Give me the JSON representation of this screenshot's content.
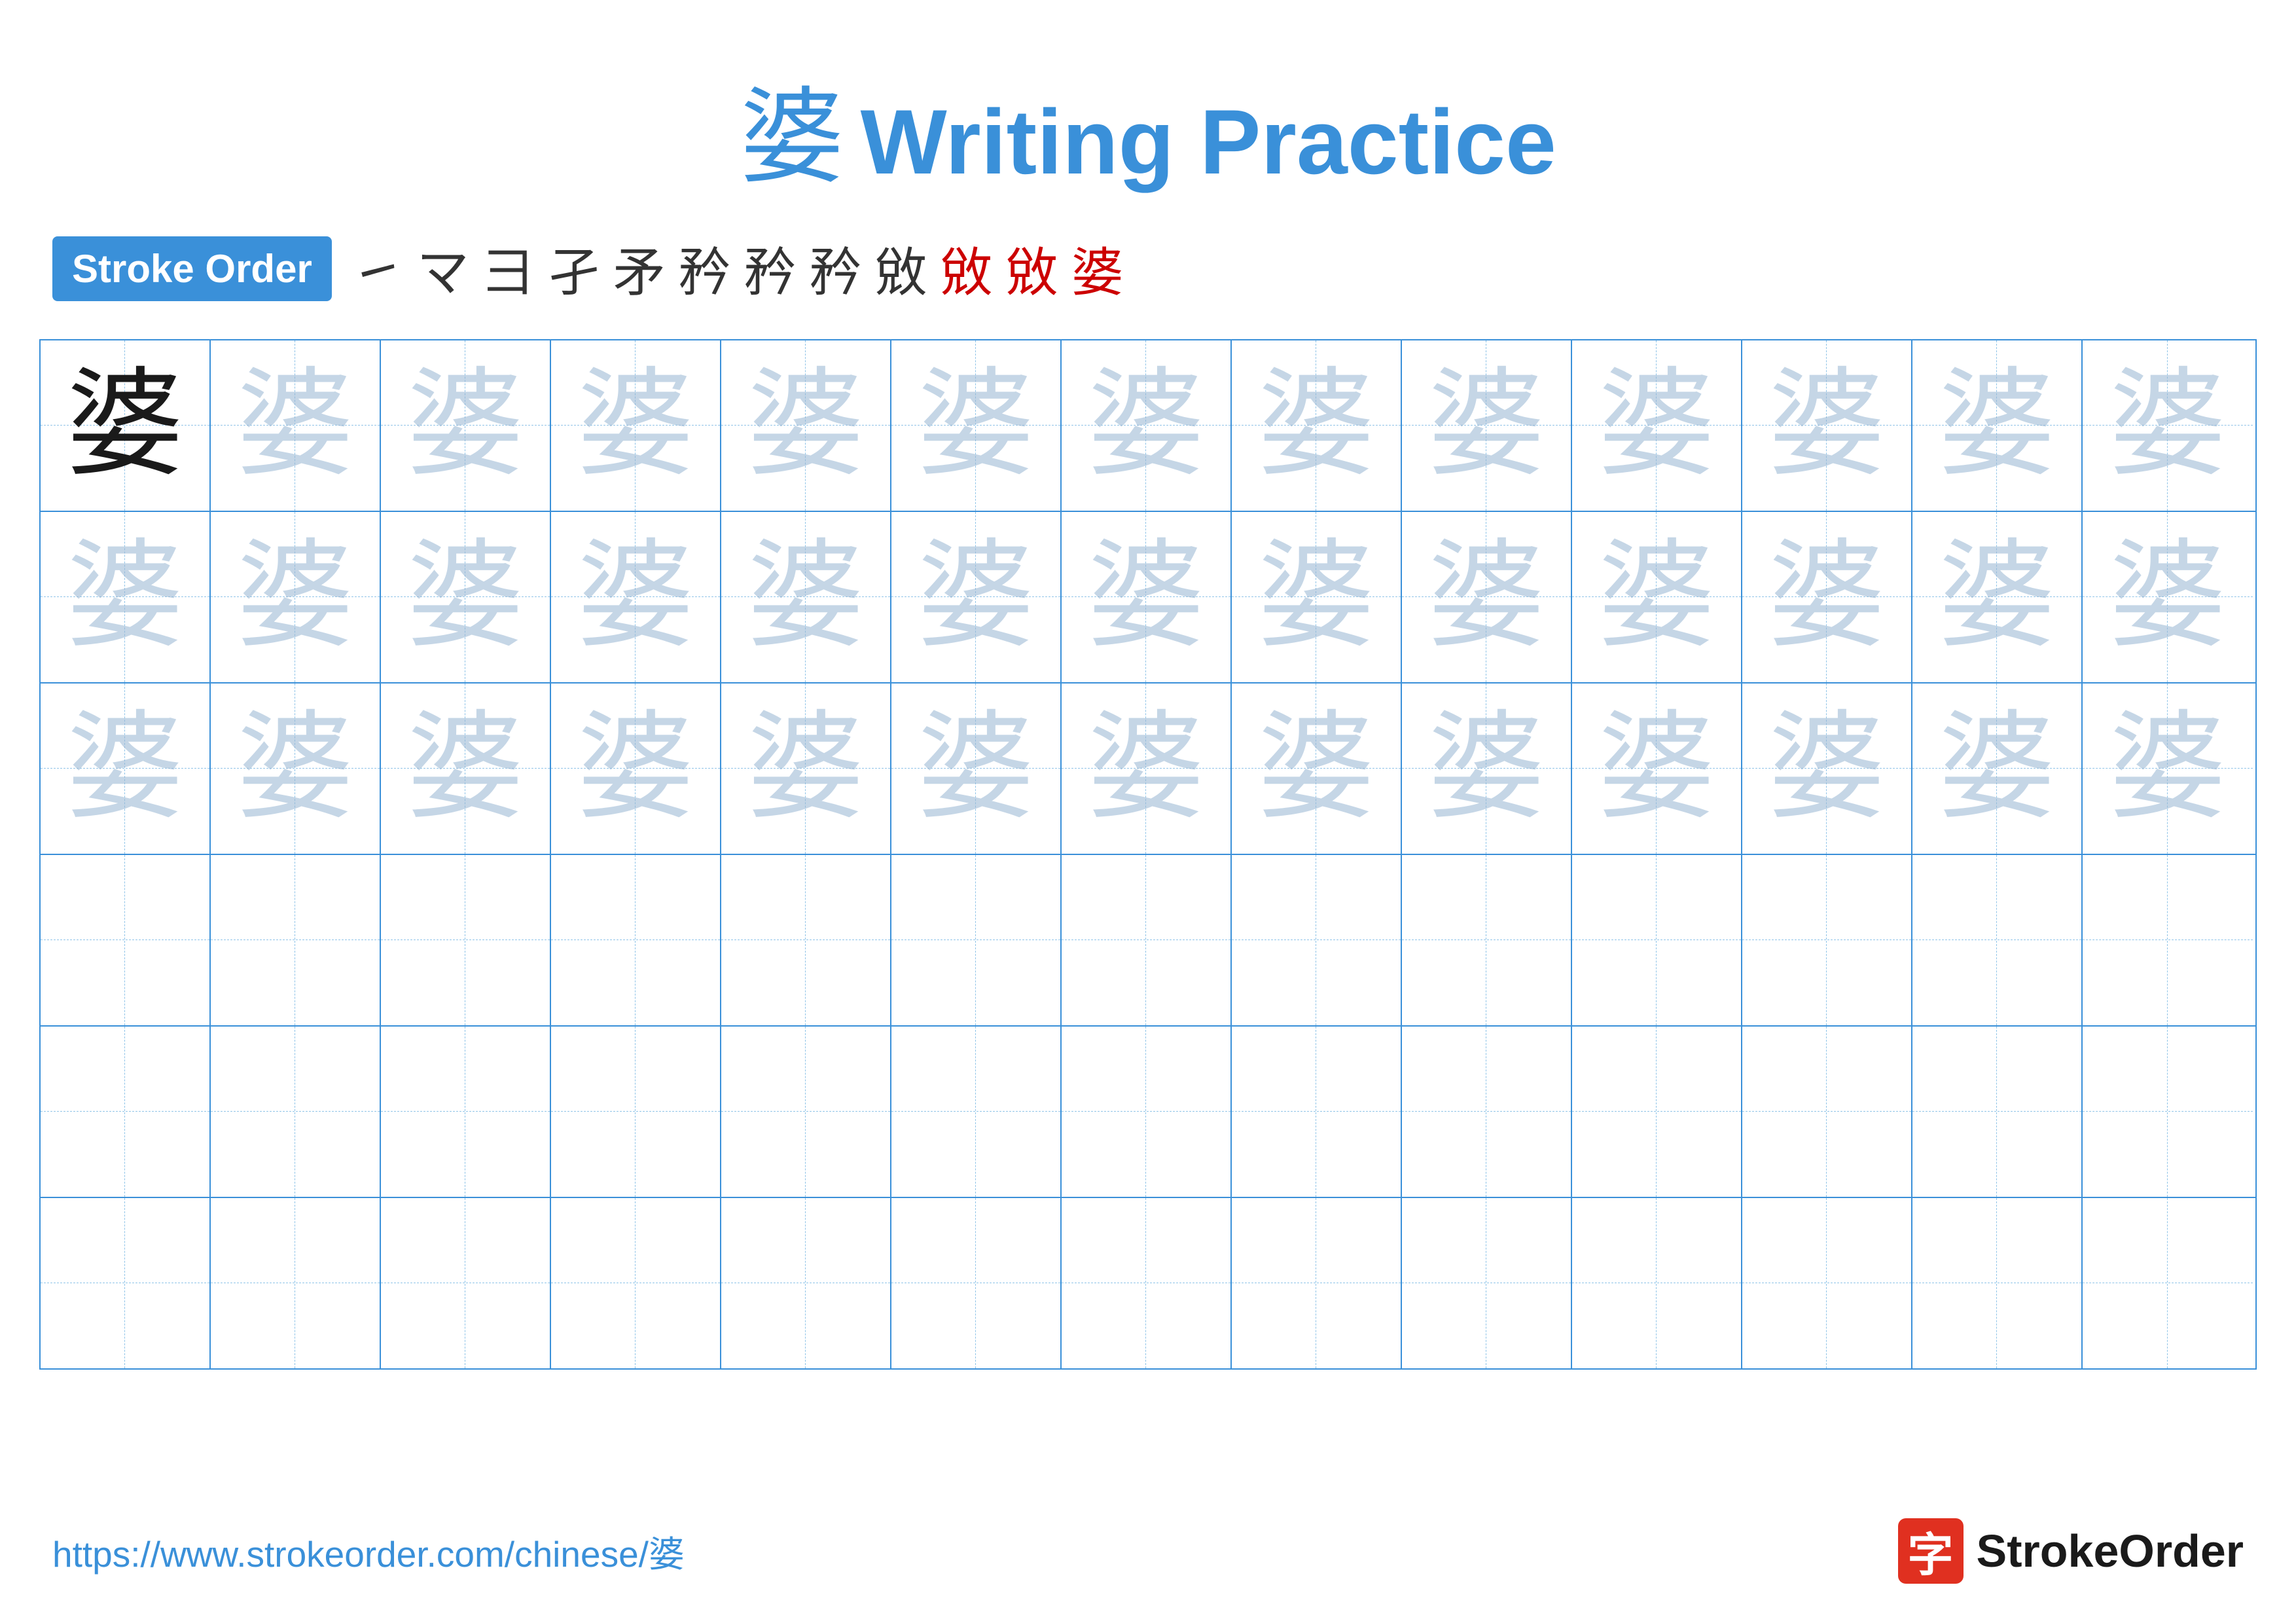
{
  "title": {
    "char": "婆",
    "text": "Writing Practice"
  },
  "stroke_order": {
    "badge_label": "Stroke Order",
    "steps": [
      "㇀",
      "㇁",
      "彐",
      "孑",
      "矛",
      "矜",
      "矜",
      "矜",
      "敓",
      "敓",
      "敓",
      "婆"
    ]
  },
  "grid": {
    "rows": 6,
    "cols": 13,
    "char": "婆",
    "filled_rows": 3
  },
  "footer": {
    "url": "https://www.strokeorder.com/chinese/婆",
    "logo_char": "字",
    "logo_text": "StrokeOrder"
  }
}
